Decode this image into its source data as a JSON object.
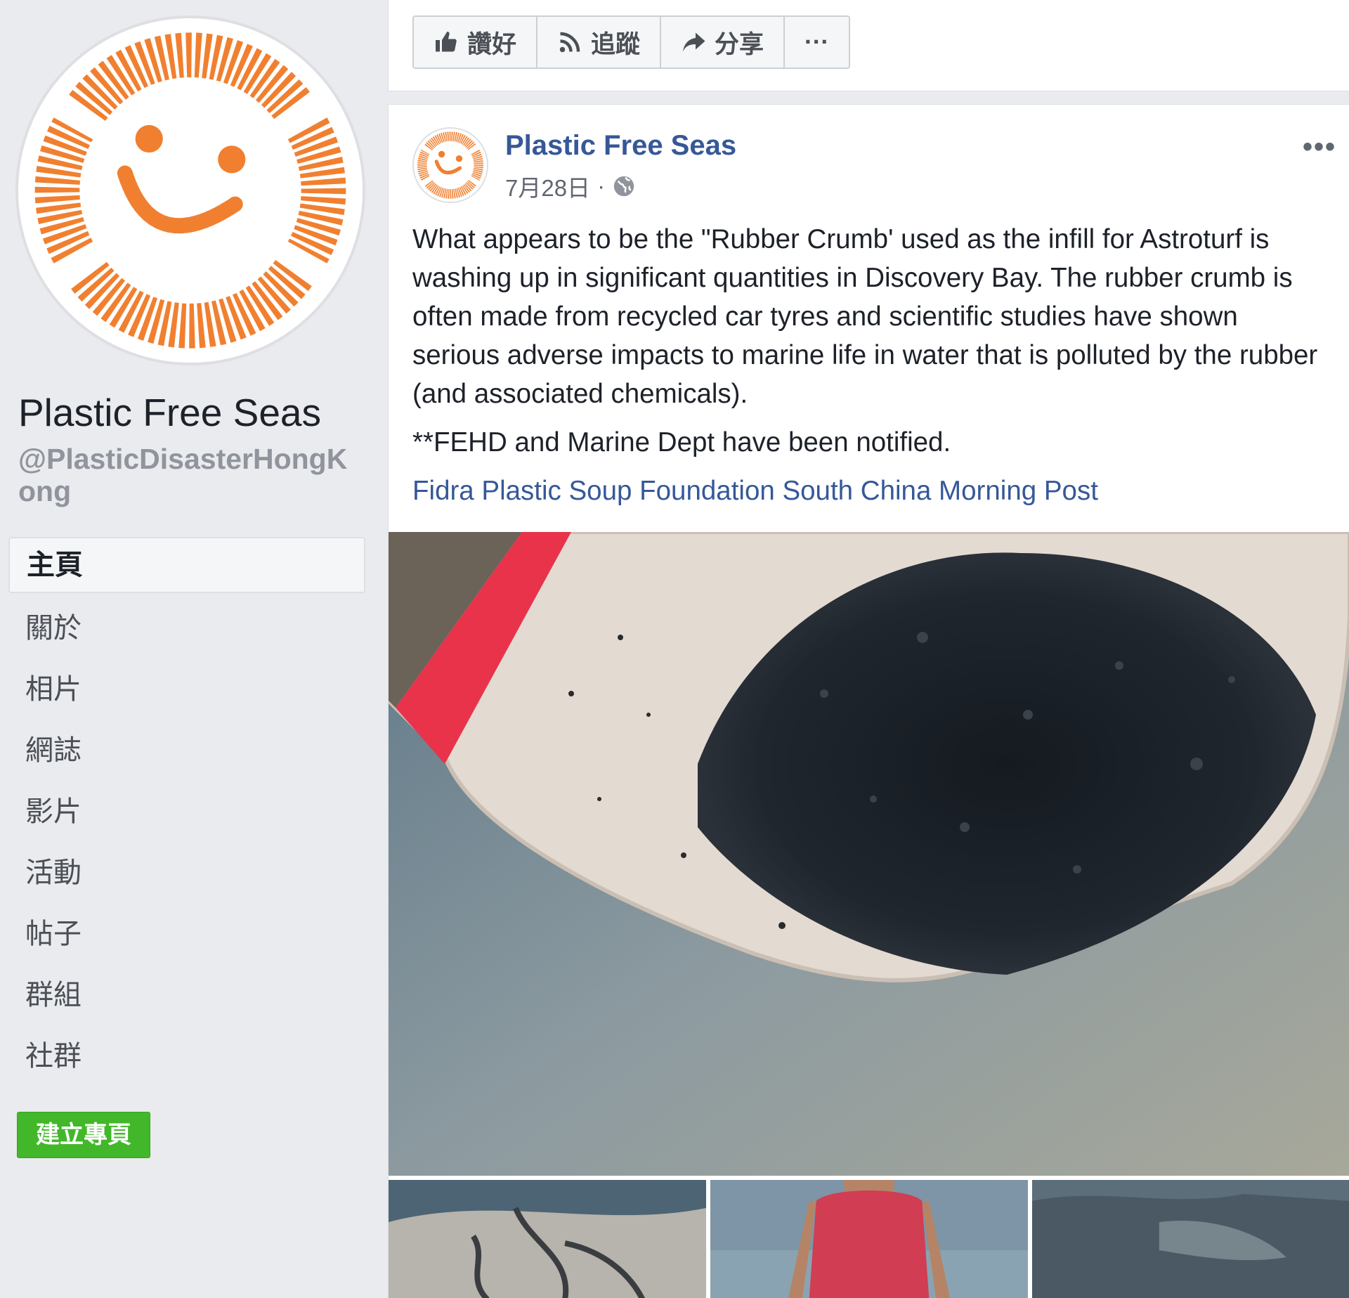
{
  "sidebar": {
    "page_name": "Plastic Free Seas",
    "page_handle": "@PlasticDisasterHongKong",
    "nav": [
      {
        "label": "主頁",
        "active": true
      },
      {
        "label": "關於"
      },
      {
        "label": "相片"
      },
      {
        "label": "網誌"
      },
      {
        "label": "影片"
      },
      {
        "label": "活動"
      },
      {
        "label": "帖子"
      },
      {
        "label": "群組"
      },
      {
        "label": "社群"
      }
    ],
    "create_page_label": "建立專頁"
  },
  "actions": {
    "like_label": "讚好",
    "follow_label": "追蹤",
    "share_label": "分享",
    "more_label": "···"
  },
  "post": {
    "author": "Plastic Free Seas",
    "date": "7月28日",
    "separator": "·",
    "more": "•••",
    "paragraph1": "What appears to be the \"Rubber Crumb' used as the infill for Astroturf is washing up in significant quantities in Discovery Bay. The rubber crumb is often made from recycled car tyres and scientific studies have shown serious adverse impacts to marine life in water that is polluted by the rubber (and associated chemicals).",
    "paragraph2": "**FEHD and Marine Dept have been notified.",
    "tags": "Fidra Plastic Soup Foundation South China Morning Post"
  },
  "colors": {
    "link_blue": "#365899",
    "logo_orange": "#f08030",
    "create_green": "#42b72a",
    "background": "#e9ebee"
  },
  "icons": {
    "like": "thumbs-up-icon",
    "follow": "rss-icon",
    "share": "share-arrow-icon",
    "privacy": "globe-icon"
  }
}
